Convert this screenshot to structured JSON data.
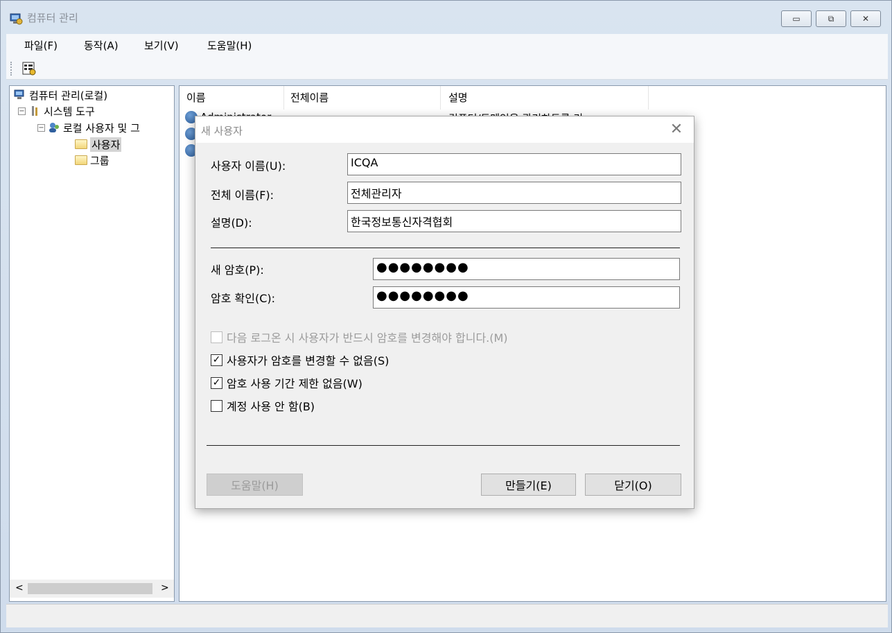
{
  "window": {
    "title": "컴퓨터 관리",
    "icon": "computer-management-icon"
  },
  "menu": [
    "파일(F)",
    "동작(A)",
    "보기(V)",
    "도움말(H)"
  ],
  "tree": {
    "root": "컴퓨터 관리(로컬)",
    "system_tools": "시스템 도구",
    "local_users": "로컬 사용자 및 그",
    "users": "사용자",
    "groups": "그룹"
  },
  "list": {
    "columns": [
      "이름",
      "전체이름",
      "설명"
    ],
    "first_row_name": "Administrator",
    "first_row_desc": "컴퓨터/도메인을 관리하도록 기"
  },
  "dialog": {
    "title": "새 사용자",
    "username_label": "사용자 이름(U):",
    "username_value": "ICQA",
    "fullname_label": "전체 이름(F):",
    "fullname_value": "전체관리자",
    "description_label": "설명(D):",
    "description_value": "한국정보통신자격협회",
    "password_label": "새 암호(P):",
    "password_value": "●●●●●●●●",
    "confirm_label": "암호 확인(C):",
    "confirm_value": "●●●●●●●●",
    "checkboxes": [
      {
        "label": "다음 로그온 시 사용자가 반드시 암호를 변경해야 합니다.(M)",
        "checked": false,
        "disabled": true
      },
      {
        "label": "사용자가 암호를 변경할 수 없음(S)",
        "checked": true,
        "disabled": false
      },
      {
        "label": "암호 사용 기간 제한 없음(W)",
        "checked": true,
        "disabled": false
      },
      {
        "label": "계정 사용 안 함(B)",
        "checked": false,
        "disabled": false
      }
    ],
    "help_button": "도움말(H)",
    "create_button": "만들기(E)",
    "close_button": "닫기(O)"
  }
}
